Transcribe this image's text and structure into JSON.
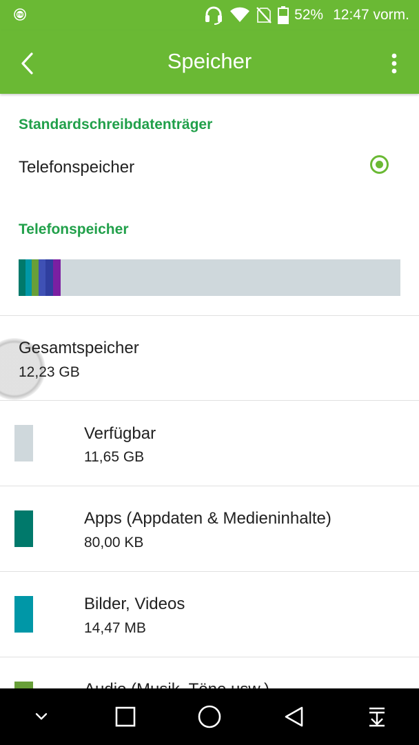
{
  "status_bar": {
    "battery_percent": "52%",
    "time": "12:47 vorm.",
    "icons": [
      "fm-radio-icon",
      "headset-icon",
      "wifi-icon",
      "no-sim-icon",
      "battery-icon"
    ],
    "battery_level": 0.52
  },
  "app_bar": {
    "title": "Speicher",
    "back_icon": "back-arrow-icon",
    "menu_icon": "overflow-menu-icon"
  },
  "default_storage": {
    "header": "Standardschreibdatenträger",
    "option_label": "Telefonspeicher",
    "selected": true
  },
  "phone_storage": {
    "header": "Telefonspeicher",
    "usage_segments": [
      {
        "color": "#00796b"
      },
      {
        "color": "#0097a7"
      },
      {
        "color": "#689f38"
      },
      {
        "color": "#3f51b5"
      },
      {
        "color": "#303f9f"
      },
      {
        "color": "#7b1fa2"
      }
    ],
    "remainder_color": "#cfd8dc"
  },
  "total": {
    "label": "Gesamtspeicher",
    "value": "12,23 GB"
  },
  "categories": [
    {
      "label": "Verfügbar",
      "value": "11,65 GB",
      "color": "#cfd8dc"
    },
    {
      "label": "Apps (Appdaten & Medieninhalte)",
      "value": "80,00 KB",
      "color": "#00796b"
    },
    {
      "label": "Bilder, Videos",
      "value": "14,47 MB",
      "color": "#0097a7"
    },
    {
      "label": "Audio (Musik, Töne usw.)",
      "value": "",
      "color": "#689f38"
    }
  ],
  "nav_bar": {
    "icons": [
      "collapse-chevron-icon",
      "recents-square-icon",
      "home-circle-icon",
      "back-triangle-icon",
      "pull-down-icon"
    ]
  },
  "colors": {
    "accent": "#6ab934",
    "section_header": "#21a04a"
  }
}
